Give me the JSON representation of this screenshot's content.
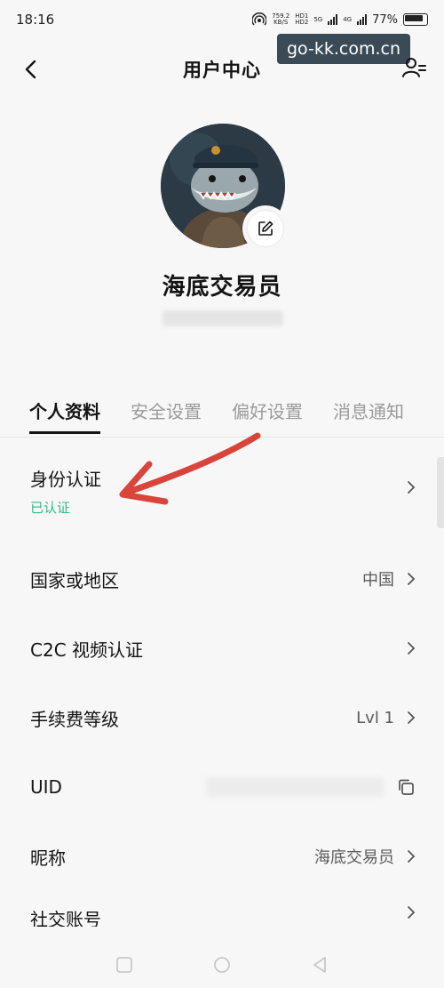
{
  "status_bar": {
    "time": "18:16",
    "speed_value": "759.2",
    "speed_unit": "KB/S",
    "hd_1": "HD1",
    "hd_2": "HD2",
    "net_1": "5G",
    "net_2": "4G",
    "battery": "77%"
  },
  "header": {
    "title": "用户中心",
    "watermark": "go-kk.com.cn"
  },
  "profile": {
    "nickname": "海底交易员"
  },
  "tabs": [
    {
      "label": "个人资料",
      "active": true
    },
    {
      "label": "安全设置",
      "active": false
    },
    {
      "label": "偏好设置",
      "active": false
    },
    {
      "label": "消息通知",
      "active": false
    }
  ],
  "rows": {
    "identity": {
      "label": "身份认证",
      "status": "已认证"
    },
    "country": {
      "label": "国家或地区",
      "value": "中国"
    },
    "c2c_video": {
      "label": "C2C 视频认证"
    },
    "fee_level": {
      "label": "手续费等级",
      "value": "Lvl 1"
    },
    "uid": {
      "label": "UID"
    },
    "nickname": {
      "label": "昵称",
      "value": "海底交易员"
    },
    "social": {
      "label": "社交账号"
    }
  },
  "colors": {
    "verified_green": "#2ebc84",
    "annotation_red": "#d9443b",
    "watermark_bg": "#3a4a57"
  }
}
